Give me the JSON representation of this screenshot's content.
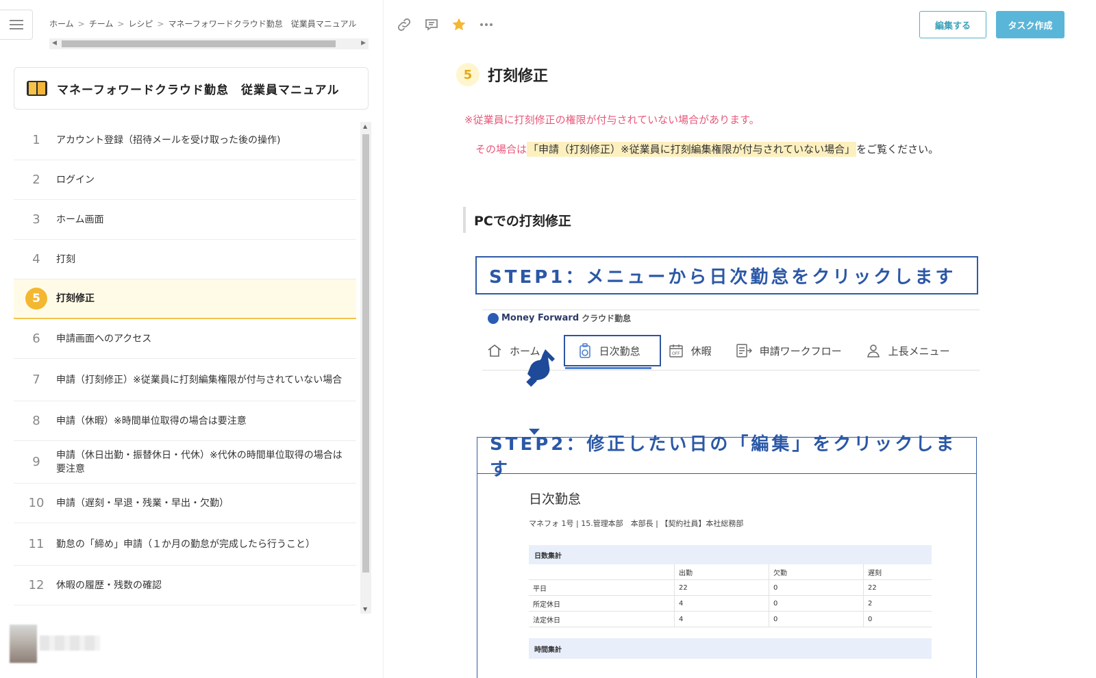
{
  "breadcrumb": [
    "ホーム",
    "チーム",
    "レシピ",
    "マネーフォワードクラウド勤怠　従業員マニュアル"
  ],
  "manual": {
    "title": "マネーフォワードクラウド勤怠　従業員マニュアル",
    "icon": "book-icon"
  },
  "toc": [
    {
      "num": "1",
      "label": "アカウント登録（招待メールを受け取った後の操作)"
    },
    {
      "num": "2",
      "label": "ログイン"
    },
    {
      "num": "3",
      "label": "ホーム画面"
    },
    {
      "num": "4",
      "label": "打刻"
    },
    {
      "num": "5",
      "label": "打刻修正",
      "active": true
    },
    {
      "num": "6",
      "label": "申請画面へのアクセス"
    },
    {
      "num": "7",
      "label": "申請（打刻修正）※従業員に打刻編集権限が付与されていない場合"
    },
    {
      "num": "8",
      "label": "申請（休暇）※時間単位取得の場合は要注意"
    },
    {
      "num": "9",
      "label": "申請（休日出勤・振替休日・代休）※代休の時間単位取得の場合は要注意"
    },
    {
      "num": "10",
      "label": "申請（遅刻・早退・残業・早出・欠勤）"
    },
    {
      "num": "11",
      "label": "勤怠の「締め」申請（１か月の勤怠が完成したら行うこと）"
    },
    {
      "num": "12",
      "label": "休暇の履歴・残数の確認"
    }
  ],
  "toolbar": {
    "icons": [
      "link-icon",
      "comment-icon",
      "star-icon",
      "more-icon"
    ],
    "edit_label": "編集する",
    "task_label": "タスク作成",
    "accent": "#5ab6d8"
  },
  "content": {
    "section_num": "5",
    "section_title": "打刻修正",
    "note": "※従業員に打刻修正の権限が付与されていない場合があります。",
    "para_prefix": "その場合は",
    "para_link": "「申請（打刻修正）※従業員に打刻編集権限が付与されていない場合」",
    "para_suffix": "をご覧ください。",
    "subheading": "PCでの打刻修正",
    "step1": "STEP1：メニューから日次勤怠をクリックします",
    "step2": "STEP2：修正したい日の「編集」をクリックします"
  },
  "mf": {
    "logo": "Money Forward",
    "service": "クラウド勤怠",
    "nav": [
      "ホーム",
      "日次勤怠",
      "休暇",
      "申請ワークフロー",
      "上長メニュー"
    ]
  },
  "daily": {
    "title": "日次勤怠",
    "meta": "マネフォ 1号 | 15.管理本部　本部長 | 【契約社員】本社総務部",
    "band1": "日数集計",
    "headers": [
      "",
      "出勤",
      "欠勤",
      "遅刻"
    ],
    "rows": [
      [
        "平日",
        "22",
        "0",
        "22"
      ],
      [
        "所定休日",
        "4",
        "0",
        "2"
      ],
      [
        "法定休日",
        "4",
        "0",
        "0"
      ]
    ],
    "band2": "時間集計"
  }
}
